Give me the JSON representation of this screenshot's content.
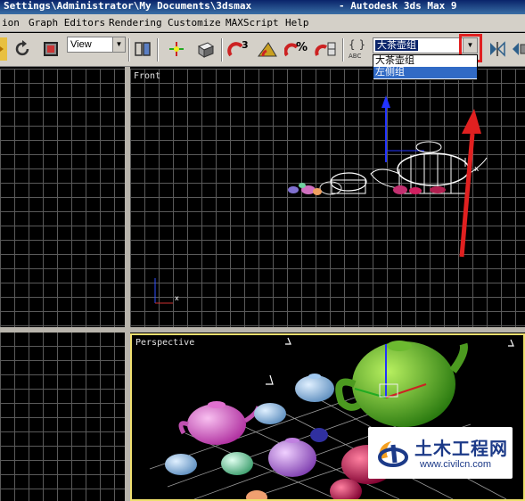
{
  "window": {
    "title_path": "Settings\\Administrator\\My Documents\\3dsmax",
    "app_title": "-  Autodesk 3ds Max 9"
  },
  "menu": {
    "items": [
      "ion",
      "Graph Editors",
      "Rendering",
      "Customize",
      "MAXScript",
      "Help"
    ]
  },
  "toolbar": {
    "reference_coord_system": "View",
    "selection_set_value": "大茶壶组",
    "selection_set_options": [
      "大茶壶组",
      "左侧组"
    ],
    "icons": [
      "select-arrow-icon",
      "undo-rotate-icon",
      "select-region-icon",
      "mirror-object-icon",
      "move-gizmo-icon",
      "render-box-icon",
      "snap-3-icon",
      "angle-snap-icon",
      "percent-snap-icon",
      "spinner-snap-icon",
      "named-selection-icon",
      "mirror-icon",
      "align-icon"
    ]
  },
  "viewports": {
    "front_label": "Front",
    "perspective_label": "Perspective"
  },
  "watermark": {
    "title": "土木工程网",
    "url": "www.civilcn.com"
  },
  "colors": {
    "highlight": "#e02020",
    "viewport_active_border": "#f0e070",
    "selection_blue": "#316ac5"
  }
}
